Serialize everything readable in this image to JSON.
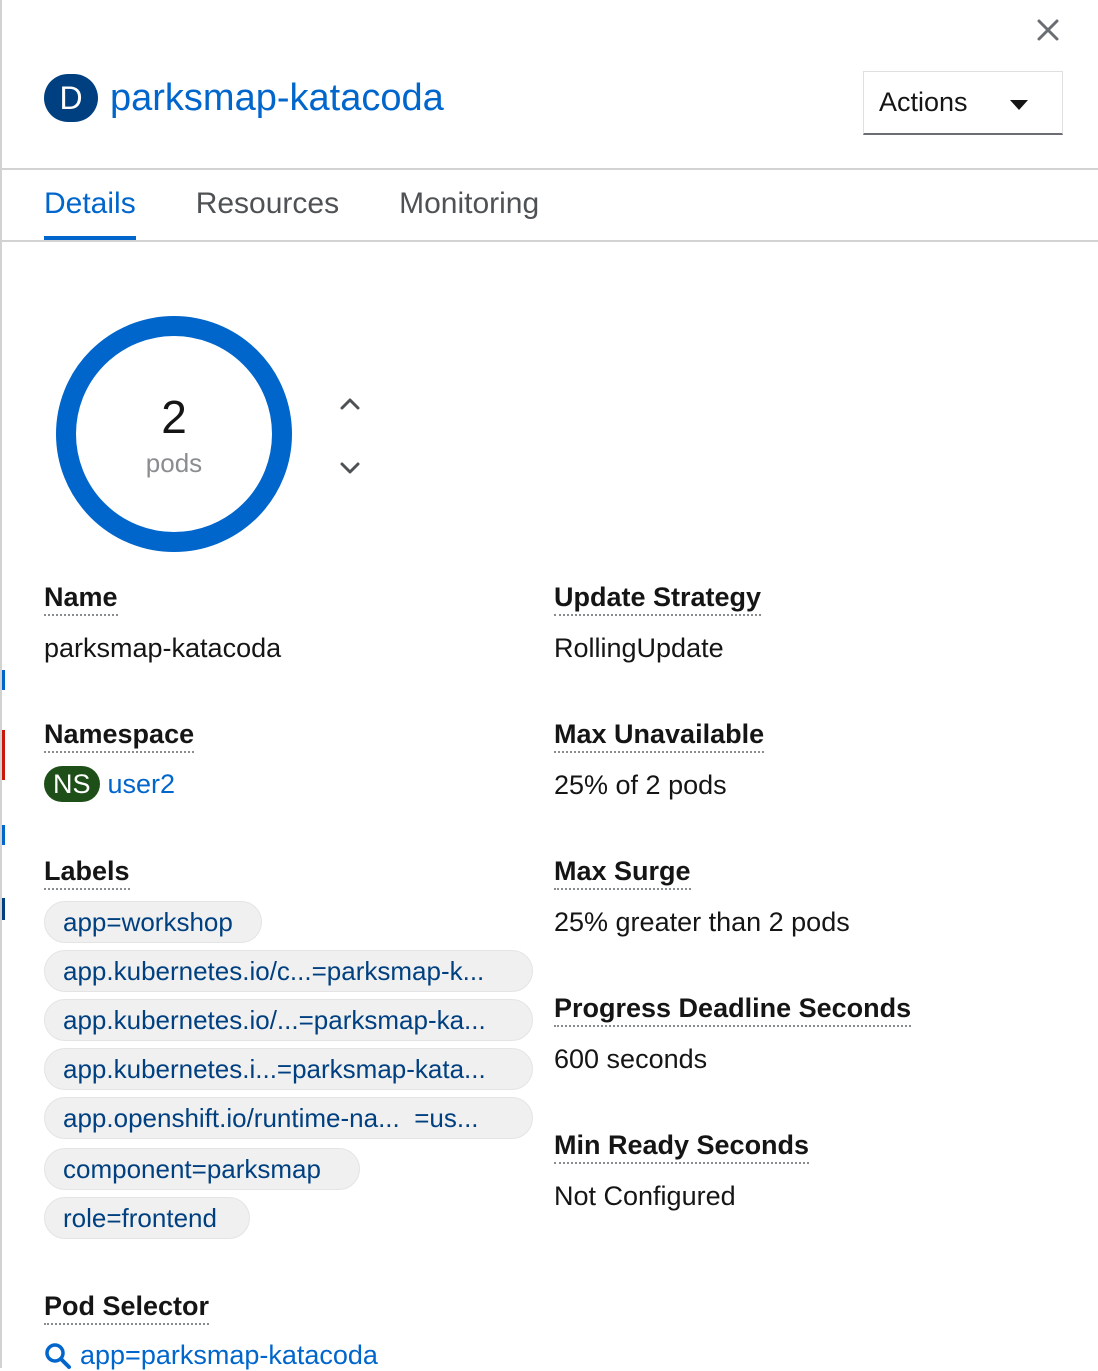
{
  "header": {
    "badge": "D",
    "name": "parksmap-katacoda",
    "actions_label": "Actions"
  },
  "tabs": [
    {
      "label": "Details",
      "active": true
    },
    {
      "label": "Resources",
      "active": false
    },
    {
      "label": "Monitoring",
      "active": false
    }
  ],
  "pods": {
    "count": "2",
    "unit": "pods"
  },
  "details": {
    "name_label": "Name",
    "name_value": "parksmap-katacoda",
    "namespace_label": "Namespace",
    "namespace_badge": "NS",
    "namespace_value": "user2",
    "labels_label": "Labels",
    "labels": [
      "app=workshop",
      "app.kubernetes.io/c...=parksmap-k...",
      "app.kubernetes.io/...=parksmap-ka...",
      "app.kubernetes.i...=parksmap-kata...",
      "app.openshift.io/runtime-na...  =us...",
      "component=parksmap",
      "role=frontend"
    ],
    "pod_selector_label": "Pod Selector",
    "pod_selector_value": "app=parksmap-katacoda",
    "update_strategy_label": "Update Strategy",
    "update_strategy_value": "RollingUpdate",
    "max_unavailable_label": "Max Unavailable",
    "max_unavailable_value": "25% of 2 pods",
    "max_surge_label": "Max Surge",
    "max_surge_value": "25% greater than 2 pods",
    "progress_deadline_label": "Progress Deadline Seconds",
    "progress_deadline_value": "600 seconds",
    "min_ready_label": "Min Ready Seconds",
    "min_ready_value": "Not Configured"
  },
  "colors": {
    "accent": "#0066cc",
    "badge_deployment": "#004080",
    "badge_namespace": "#1e4f18"
  }
}
